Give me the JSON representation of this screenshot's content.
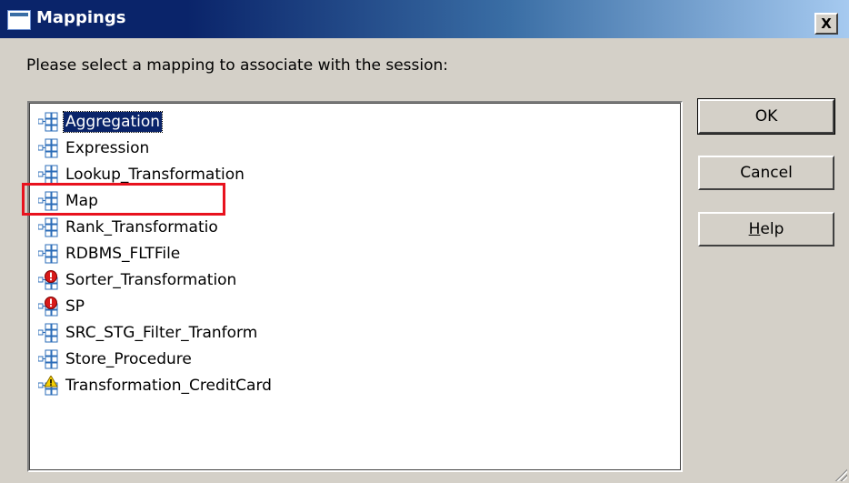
{
  "window": {
    "title": "Mappings",
    "close_label": "X"
  },
  "prompt": "Please select a mapping to associate with the session:",
  "mappings": [
    {
      "label": "Aggregation",
      "icon": "mapping-icon",
      "selected": true
    },
    {
      "label": "Expression",
      "icon": "mapping-icon"
    },
    {
      "label": "Lookup_Transformation",
      "icon": "mapping-icon"
    },
    {
      "label": "Map",
      "icon": "mapping-icon",
      "highlighted": true
    },
    {
      "label": "Rank_Transformatio",
      "icon": "mapping-icon"
    },
    {
      "label": "RDBMS_FLTFile",
      "icon": "mapping-icon"
    },
    {
      "label": "Sorter_Transformation",
      "icon": "invalid-mapping-icon"
    },
    {
      "label": "SP",
      "icon": "invalid-mapping-icon"
    },
    {
      "label": "SRC_STG_Filter_Tranform",
      "icon": "mapping-icon"
    },
    {
      "label": "Store_Procedure",
      "icon": "mapping-icon"
    },
    {
      "label": "Transformation_CreditCard",
      "icon": "warning-mapping-icon"
    }
  ],
  "buttons": {
    "ok": "OK",
    "cancel": "Cancel",
    "help_mnemonic": "H",
    "help_rest": "elp"
  },
  "colors": {
    "title_bar": "#0a246a",
    "selection": "#0a246a",
    "highlight_box": "#e8121e",
    "dialog_bg": "#d4d0c8"
  }
}
